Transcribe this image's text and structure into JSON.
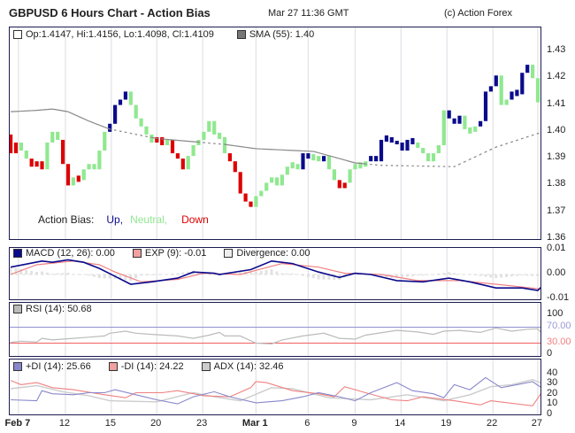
{
  "header": {
    "title": "GBPUSD 6 Hours Chart - Action Bias",
    "timestamp": "Mar 27 11:36 GMT",
    "copyright": "(c) Action Forex"
  },
  "legend": {
    "ohlc": "Op:1.4147, Hi:1.4156, Lo:1.4098, Cl:1.4109",
    "sma": "SMA (55): 1.40",
    "bias_label": "Action Bias:",
    "up": "Up,",
    "neutral": "Neutral,",
    "down": "Down",
    "macd": "MACD (12, 26): 0.00",
    "exp": "EXP (9): -0.01",
    "div": "Divergence: 0.00",
    "rsi": "RSI (14): 50.68",
    "pdi": "+DI (14): 25.66",
    "mdi": "-DI (14): 24.22",
    "adx": "ADX (14): 32.46"
  },
  "colors": {
    "up": "#0a0a8c",
    "neutral": "#90e890",
    "down": "#dd0000",
    "macd": "#0a0a8c",
    "exp": "#f08080",
    "rsi": "#bbbbbb",
    "pdi": "#8888cc",
    "mdi": "#f08080",
    "adx": "#cccccc"
  },
  "chart_data": [
    {
      "type": "candlestick",
      "title": "GBPUSD 6 Hours Chart - Action Bias",
      "ylim": [
        1.36,
        1.43
      ],
      "yticks": [
        "1.43",
        "1.42",
        "1.41",
        "1.40",
        "1.39",
        "1.38",
        "1.37",
        "1.36"
      ],
      "xticks": [
        {
          "label": "Feb 7",
          "i": 1.5
        },
        {
          "label": "12",
          "i": 10.5
        },
        {
          "label": "15",
          "i": 19.3
        },
        {
          "label": "20",
          "i": 28
        },
        {
          "label": "23",
          "i": 36.8
        },
        {
          "label": "Mar 1",
          "i": 47
        },
        {
          "label": "6",
          "i": 57
        },
        {
          "label": "9",
          "i": 66
        },
        {
          "label": "14",
          "i": 74.8
        },
        {
          "label": "19",
          "i": 83.6
        },
        {
          "label": "22",
          "i": 92.4
        },
        {
          "label": "27",
          "i": 101
        }
      ],
      "start": 1.399,
      "bars": [
        [
          1.392,
          "D"
        ],
        [
          1.396,
          "D"
        ],
        [
          1.393,
          "N"
        ],
        [
          1.39,
          "N"
        ],
        [
          1.387,
          "D"
        ],
        [
          1.389,
          "D"
        ],
        [
          1.386,
          "D"
        ],
        [
          1.396,
          "N"
        ],
        [
          1.4,
          "N"
        ],
        [
          1.397,
          "N"
        ],
        [
          1.388,
          "D"
        ],
        [
          1.38,
          "D"
        ],
        [
          1.383,
          "N"
        ],
        [
          1.382,
          "D"
        ],
        [
          1.386,
          "N"
        ],
        [
          1.388,
          "N"
        ],
        [
          1.386,
          "N"
        ],
        [
          1.393,
          "N"
        ],
        [
          1.4,
          "N"
        ],
        [
          1.403,
          "U"
        ],
        [
          1.41,
          "U"
        ],
        [
          1.412,
          "U"
        ],
        [
          1.415,
          "U"
        ],
        [
          1.41,
          "N"
        ],
        [
          1.405,
          "N"
        ],
        [
          1.402,
          "N"
        ],
        [
          1.399,
          "N"
        ],
        [
          1.396,
          "N"
        ],
        [
          1.398,
          "D"
        ],
        [
          1.395,
          "D"
        ],
        [
          1.397,
          "N"
        ],
        [
          1.392,
          "D"
        ],
        [
          1.39,
          "D"
        ],
        [
          1.386,
          "D"
        ],
        [
          1.391,
          "N"
        ],
        [
          1.395,
          "N"
        ],
        [
          1.397,
          "N"
        ],
        [
          1.4,
          "N"
        ],
        [
          1.404,
          "N"
        ],
        [
          1.399,
          "N"
        ],
        [
          1.398,
          "N"
        ],
        [
          1.392,
          "N"
        ],
        [
          1.389,
          "D"
        ],
        [
          1.385,
          "D"
        ],
        [
          1.377,
          "D"
        ],
        [
          1.374,
          "D"
        ],
        [
          1.372,
          "D"
        ],
        [
          1.376,
          "N"
        ],
        [
          1.378,
          "N"
        ],
        [
          1.381,
          "N"
        ],
        [
          1.383,
          "N"
        ],
        [
          1.38,
          "N"
        ],
        [
          1.384,
          "N"
        ],
        [
          1.387,
          "N"
        ],
        [
          1.388,
          "N"
        ],
        [
          1.386,
          "N"
        ],
        [
          1.392,
          "U"
        ],
        [
          1.39,
          "U"
        ],
        [
          1.391,
          "N"
        ],
        [
          1.389,
          "N"
        ],
        [
          1.391,
          "U"
        ],
        [
          1.386,
          "N"
        ],
        [
          1.382,
          "N"
        ],
        [
          1.379,
          "D"
        ],
        [
          1.381,
          "D"
        ],
        [
          1.386,
          "N"
        ],
        [
          1.388,
          "N"
        ],
        [
          1.387,
          "N"
        ],
        [
          1.389,
          "N"
        ],
        [
          1.391,
          "U"
        ],
        [
          1.389,
          "U"
        ],
        [
          1.397,
          "U"
        ],
        [
          1.398,
          "U"
        ],
        [
          1.396,
          "U"
        ],
        [
          1.396,
          "U"
        ],
        [
          1.393,
          "U"
        ],
        [
          1.397,
          "U"
        ],
        [
          1.396,
          "U"
        ],
        [
          1.394,
          "N"
        ],
        [
          1.392,
          "N"
        ],
        [
          1.389,
          "N"
        ],
        [
          1.392,
          "N"
        ],
        [
          1.395,
          "N"
        ],
        [
          1.408,
          "N"
        ],
        [
          1.405,
          "U"
        ],
        [
          1.403,
          "U"
        ],
        [
          1.406,
          "U"
        ],
        [
          1.401,
          "N"
        ],
        [
          1.4,
          "N"
        ],
        [
          1.402,
          "N"
        ],
        [
          1.404,
          "U"
        ],
        [
          1.415,
          "U"
        ],
        [
          1.417,
          "U"
        ],
        [
          1.421,
          "U"
        ],
        [
          1.41,
          "N"
        ],
        [
          1.412,
          "N"
        ],
        [
          1.415,
          "U"
        ],
        [
          1.414,
          "U"
        ],
        [
          1.422,
          "U"
        ],
        [
          1.425,
          "U"
        ],
        [
          1.42,
          "N"
        ],
        [
          1.411,
          "N"
        ]
      ],
      "sma": [
        [
          0,
          1.4075
        ],
        [
          5,
          1.408
        ],
        [
          8,
          1.4085
        ],
        [
          11,
          1.4075
        ],
        [
          15,
          1.404
        ],
        [
          19,
          1.401
        ],
        [
          28,
          1.3975
        ],
        [
          41,
          1.3953
        ],
        [
          47,
          1.3937
        ],
        [
          58,
          1.3927
        ],
        [
          66,
          1.3884
        ],
        [
          71,
          1.3875
        ],
        [
          85,
          1.387
        ],
        [
          93,
          1.3943
        ],
        [
          102,
          1.4
        ]
      ]
    },
    {
      "type": "line",
      "name": "MACD",
      "ylim": [
        -0.0105,
        0.0105
      ],
      "yticks": [
        "0.01",
        "0.00",
        "-0.01"
      ],
      "macd": [
        [
          0,
          0.003
        ],
        [
          6,
          0.0055
        ],
        [
          8,
          0.005
        ],
        [
          11,
          0.006
        ],
        [
          14,
          0.005
        ],
        [
          17,
          0.0025
        ],
        [
          23,
          -0.004
        ],
        [
          27,
          -0.003
        ],
        [
          32,
          -0.0015
        ],
        [
          35,
          0.001
        ],
        [
          39,
          0.0005
        ],
        [
          40,
          0
        ],
        [
          46,
          0.002
        ],
        [
          50,
          0.0055
        ],
        [
          54,
          0.0045
        ],
        [
          59,
          0.001
        ],
        [
          63,
          -0.0012
        ],
        [
          66,
          0.0005
        ],
        [
          69,
          0
        ],
        [
          74,
          -0.0025
        ],
        [
          79,
          -0.003
        ],
        [
          84,
          -0.0015
        ],
        [
          88,
          -0.003
        ],
        [
          93,
          -0.0055
        ],
        [
          98,
          -0.0055
        ],
        [
          101,
          -0.0065
        ],
        [
          102,
          -0.0045
        ]
      ],
      "exp": [
        [
          0,
          0
        ],
        [
          5,
          0.004
        ],
        [
          12,
          0.0055
        ],
        [
          17,
          0.004
        ],
        [
          20,
          0.001
        ],
        [
          25,
          -0.003
        ],
        [
          32,
          -0.002
        ],
        [
          37,
          0.0005
        ],
        [
          44,
          0
        ],
        [
          52,
          0.0045
        ],
        [
          59,
          0.003
        ],
        [
          64,
          0.0005
        ],
        [
          71,
          0
        ],
        [
          78,
          -0.0025
        ],
        [
          86,
          -0.0025
        ],
        [
          93,
          -0.004
        ],
        [
          102,
          -0.006
        ]
      ]
    },
    {
      "type": "line",
      "name": "RSI",
      "ylim": [
        0,
        100
      ],
      "yticks": [
        "100",
        "70.00",
        "30.00",
        "0"
      ],
      "levels": [
        70,
        30
      ],
      "rsi": [
        [
          0,
          32
        ],
        [
          2,
          35
        ],
        [
          5,
          33
        ],
        [
          6,
          42
        ],
        [
          8,
          38
        ],
        [
          12,
          42
        ],
        [
          15,
          45
        ],
        [
          18,
          48
        ],
        [
          19,
          55
        ],
        [
          22,
          60
        ],
        [
          24,
          55
        ],
        [
          27,
          52
        ],
        [
          32,
          48
        ],
        [
          35,
          42
        ],
        [
          38,
          50
        ],
        [
          40,
          57
        ],
        [
          41,
          48
        ],
        [
          44,
          48
        ],
        [
          47,
          30
        ],
        [
          50,
          28
        ],
        [
          52,
          38
        ],
        [
          56,
          48
        ],
        [
          60,
          55
        ],
        [
          63,
          42
        ],
        [
          66,
          40
        ],
        [
          68,
          50
        ],
        [
          72,
          58
        ],
        [
          74,
          62
        ],
        [
          78,
          58
        ],
        [
          81,
          52
        ],
        [
          83,
          60
        ],
        [
          86,
          62
        ],
        [
          90,
          57
        ],
        [
          93,
          68
        ],
        [
          96,
          60
        ],
        [
          99,
          65
        ],
        [
          101,
          66
        ],
        [
          102,
          51
        ]
      ]
    },
    {
      "type": "line",
      "name": "DMI",
      "ylim": [
        0,
        42
      ],
      "yticks": [
        "40",
        "30",
        "20",
        "10",
        "0"
      ],
      "pdi": [
        [
          0,
          15
        ],
        [
          5,
          14
        ],
        [
          6,
          24
        ],
        [
          8,
          21
        ],
        [
          12,
          20
        ],
        [
          15,
          22
        ],
        [
          18,
          22
        ],
        [
          20,
          25
        ],
        [
          24,
          20
        ],
        [
          28,
          15
        ],
        [
          32,
          11
        ],
        [
          35,
          18
        ],
        [
          39,
          23
        ],
        [
          42,
          18
        ],
        [
          47,
          12
        ],
        [
          52,
          14
        ],
        [
          56,
          18
        ],
        [
          59,
          22
        ],
        [
          63,
          18
        ],
        [
          66,
          14
        ],
        [
          69,
          22
        ],
        [
          74,
          32
        ],
        [
          77,
          24
        ],
        [
          81,
          21
        ],
        [
          83,
          17
        ],
        [
          85,
          30
        ],
        [
          88,
          25
        ],
        [
          91,
          37
        ],
        [
          94,
          27
        ],
        [
          97,
          30
        ],
        [
          100,
          33
        ],
        [
          102,
          26
        ]
      ],
      "mdi": [
        [
          0,
          34
        ],
        [
          2,
          30
        ],
        [
          5,
          32
        ],
        [
          8,
          27
        ],
        [
          12,
          25
        ],
        [
          18,
          20
        ],
        [
          22,
          17
        ],
        [
          24,
          22
        ],
        [
          29,
          22
        ],
        [
          32,
          24
        ],
        [
          37,
          19
        ],
        [
          42,
          18
        ],
        [
          46,
          27
        ],
        [
          47,
          33
        ],
        [
          49,
          32
        ],
        [
          54,
          24
        ],
        [
          59,
          21
        ],
        [
          62,
          18
        ],
        [
          64,
          28
        ],
        [
          68,
          22
        ],
        [
          73,
          15
        ],
        [
          76,
          14
        ],
        [
          79,
          18
        ],
        [
          85,
          14
        ],
        [
          90,
          10
        ],
        [
          92,
          14
        ],
        [
          100,
          9
        ],
        [
          102,
          24
        ]
      ],
      "adx": [
        [
          0,
          26
        ],
        [
          5,
          29
        ],
        [
          10,
          23
        ],
        [
          15,
          19
        ],
        [
          19,
          14
        ],
        [
          28,
          13
        ],
        [
          35,
          22
        ],
        [
          39,
          18
        ],
        [
          44,
          14
        ],
        [
          50,
          27
        ],
        [
          54,
          26
        ],
        [
          61,
          17
        ],
        [
          69,
          15
        ],
        [
          76,
          20
        ],
        [
          83,
          14
        ],
        [
          88,
          20
        ],
        [
          92,
          28
        ],
        [
          96,
          30
        ],
        [
          100,
          35
        ],
        [
          102,
          31
        ]
      ]
    }
  ]
}
